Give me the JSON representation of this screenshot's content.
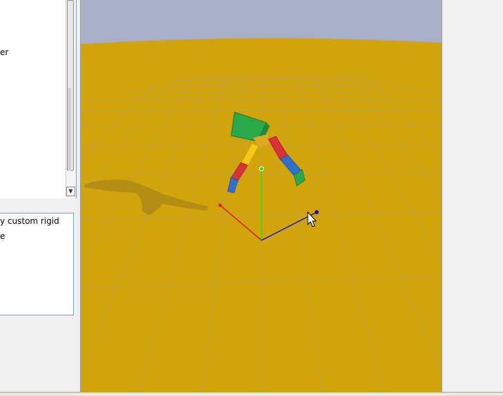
{
  "left_top_panel": {
    "visible_text": "er"
  },
  "left_bottom_panel": {
    "items": [
      "y custom rigid",
      "e"
    ]
  },
  "scrollbar": {
    "down_arrow": "▼"
  },
  "viewport": {
    "sky_color": "#a9aec9",
    "ground_color": "#d2a40c",
    "grid_color": "#bfa24a",
    "gizmo_colors": {
      "x": "#e11d1d",
      "y": "#22e022",
      "z": "#1a1aa8"
    },
    "ragdoll_colors": {
      "torso": "#2aa84a",
      "upper_leg_left": "#f5c518",
      "lower_leg_left": "#d8323c",
      "foot_left": "#2f6fd0",
      "upper_leg_right": "#d8323c",
      "lower_leg_right": "#2f6fd0",
      "foot_right": "#2aa84a"
    }
  }
}
